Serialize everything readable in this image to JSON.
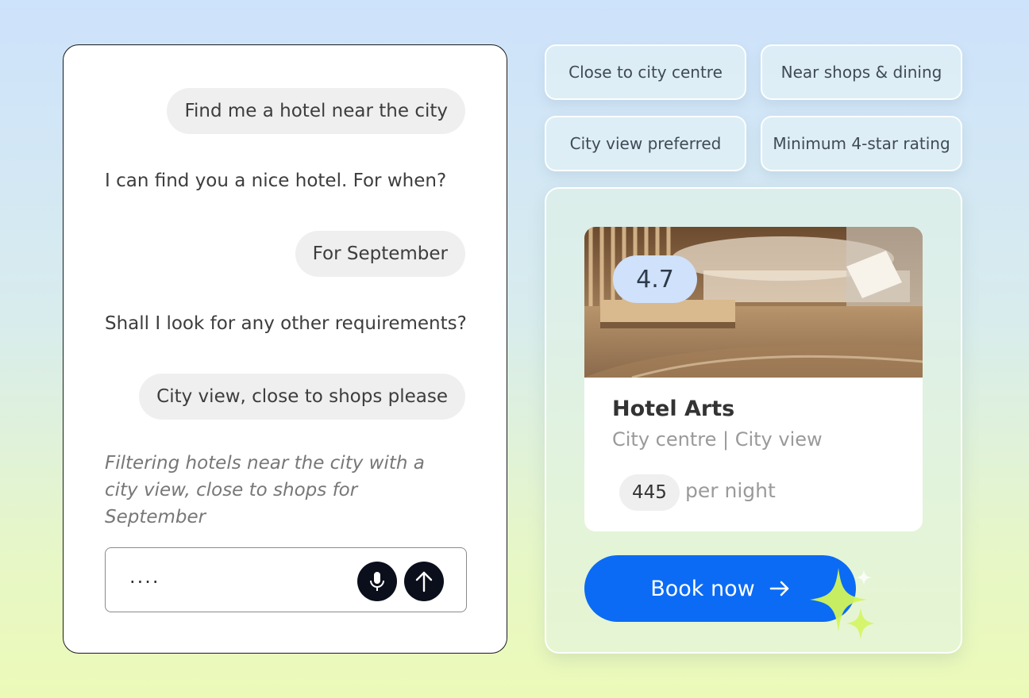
{
  "chat": {
    "messages": [
      {
        "role": "user",
        "text": "Find me a hotel near the city"
      },
      {
        "role": "assistant",
        "text": "I can find you a nice hotel. For when?"
      },
      {
        "role": "user",
        "text": "For September"
      },
      {
        "role": "assistant",
        "text": "Shall I look for any other requirements?"
      },
      {
        "role": "user",
        "text": "City view, close to shops please"
      }
    ],
    "status": "Filtering hotels near the city with a city view, close to shops for September",
    "input_value": "....",
    "mic_icon": "microphone-icon",
    "send_icon": "arrow-up-icon"
  },
  "filters": [
    "Close to city centre",
    "Near shops & dining",
    "City view preferred",
    "Minimum 4-star rating"
  ],
  "hotel": {
    "rating": "4.7",
    "name": "Hotel Arts",
    "location": "City centre | City view",
    "price": "445",
    "price_unit": "per night",
    "book_label": "Book now",
    "book_icon": "arrow-right-icon"
  },
  "colors": {
    "accent": "#0b6bf5",
    "rating_badge": "#cfe1fb",
    "sparkle": "#d2f55a"
  }
}
